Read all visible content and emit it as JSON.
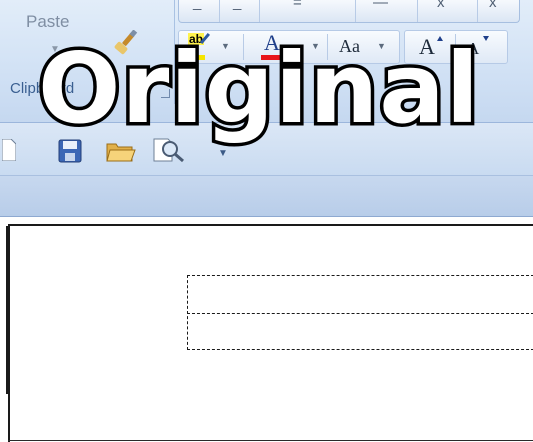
{
  "ribbon": {
    "clipboard_group": {
      "paste_label": "Paste",
      "group_label": "Clipboard"
    },
    "font_group": {
      "change_case_label": "Aa",
      "font_color_letter": "A",
      "grow_font_letter": "A",
      "shrink_font_letter": "A",
      "highlight_label": "ab",
      "highlight_color": "#f5e500",
      "font_color_bar": "#e8151a"
    }
  },
  "quick_access_toolbar": {
    "icons": [
      "new-document-icon",
      "save-icon",
      "open-folder-icon",
      "print-preview-icon",
      "customize-dropdown-icon"
    ]
  },
  "overlay": {
    "watermark_text": "Original"
  },
  "colors": {
    "ribbon_top": "#e2edf9",
    "ribbon_bottom": "#c5d8f0",
    "document_bg": "#ffffff"
  }
}
